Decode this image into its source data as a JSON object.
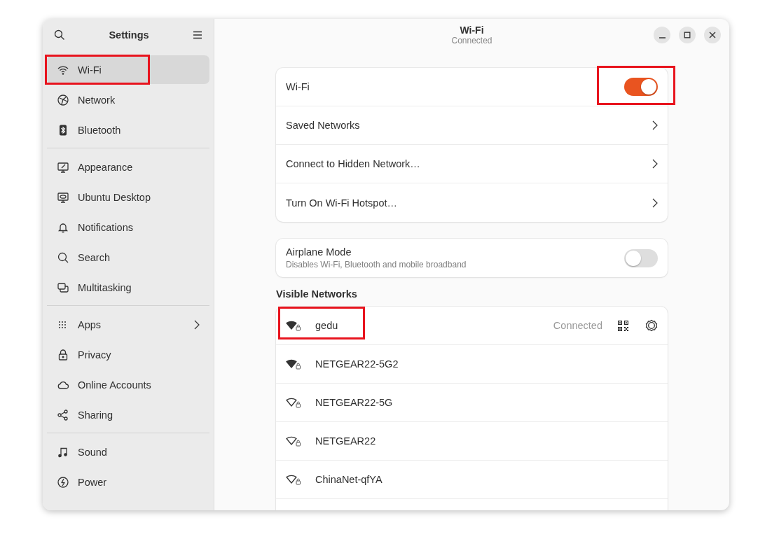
{
  "sidebar": {
    "title": "Settings",
    "groups": [
      {
        "items": [
          {
            "label": "Wi-Fi",
            "selected": true,
            "highlighted": true
          },
          {
            "label": "Network",
            "selected": false,
            "highlighted": false
          },
          {
            "label": "Bluetooth",
            "selected": false,
            "highlighted": false
          }
        ]
      },
      {
        "items": [
          {
            "label": "Appearance",
            "selected": false,
            "highlighted": false
          },
          {
            "label": "Ubuntu Desktop",
            "selected": false,
            "highlighted": false
          },
          {
            "label": "Notifications",
            "selected": false,
            "highlighted": false
          },
          {
            "label": "Search",
            "selected": false,
            "highlighted": false
          },
          {
            "label": "Multitasking",
            "selected": false,
            "highlighted": false
          }
        ]
      },
      {
        "items": [
          {
            "label": "Apps",
            "selected": false,
            "highlighted": false,
            "has_submenu": true
          },
          {
            "label": "Privacy",
            "selected": false,
            "highlighted": false
          },
          {
            "label": "Online Accounts",
            "selected": false,
            "highlighted": false
          },
          {
            "label": "Sharing",
            "selected": false,
            "highlighted": false
          }
        ]
      },
      {
        "items": [
          {
            "label": "Sound",
            "selected": false,
            "highlighted": false
          },
          {
            "label": "Power",
            "selected": false,
            "highlighted": false
          }
        ]
      }
    ]
  },
  "header": {
    "title": "Wi-Fi",
    "subtitle": "Connected"
  },
  "wifi_card": [
    {
      "kind": "switch",
      "label": "Wi-Fi",
      "on": true,
      "highlighted": true
    },
    {
      "kind": "link",
      "label": "Saved Networks"
    },
    {
      "kind": "link",
      "label": "Connect to Hidden Network…"
    },
    {
      "kind": "link",
      "label": "Turn On Wi-Fi Hotspot…"
    }
  ],
  "airplane": {
    "label": "Airplane Mode",
    "description": "Disables Wi-Fi, Bluetooth and mobile broadband",
    "on": false
  },
  "visible_networks": {
    "heading": "Visible Networks",
    "networks": [
      {
        "name": "gedu",
        "strong": true,
        "status": "Connected",
        "highlighted": true
      },
      {
        "name": "NETGEAR22-5G2",
        "strong": true,
        "highlighted": false
      },
      {
        "name": "NETGEAR22-5G",
        "strong": false,
        "highlighted": false
      },
      {
        "name": "NETGEAR22",
        "strong": false,
        "highlighted": false
      },
      {
        "name": "ChinaNet-qfYA",
        "strong": false,
        "highlighted": false
      }
    ]
  }
}
